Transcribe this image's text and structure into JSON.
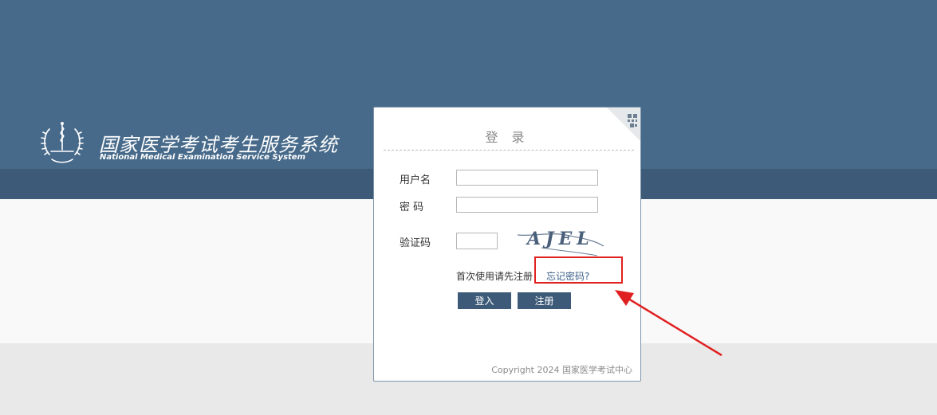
{
  "header": {
    "title": "国家医学考试考生服务系统",
    "subtitle": "National Medical Examination Service System",
    "logo_icon": "caduceus-emblem-icon"
  },
  "login": {
    "title": "登 录",
    "qr_icon": "qr-code-corner-icon",
    "username_label": "用户名",
    "username_value": "",
    "password_label": "密 码",
    "password_value": "",
    "captcha_label": "验证码",
    "captcha_value": "",
    "captcha_text": "AJEL",
    "first_use_text": "首次使用请先注册",
    "forgot_link": "忘记密码?",
    "login_button": "登入",
    "register_button": "注册"
  },
  "footer": {
    "copyright": "Copyright 2024 国家医学考试中心"
  },
  "annotation": {
    "highlight_color": "#e02020"
  },
  "colors": {
    "header_bg": "#476a8a",
    "header_band": "#3d5b78",
    "button_bg": "#3d5b78",
    "link": "#3b5f8a"
  }
}
